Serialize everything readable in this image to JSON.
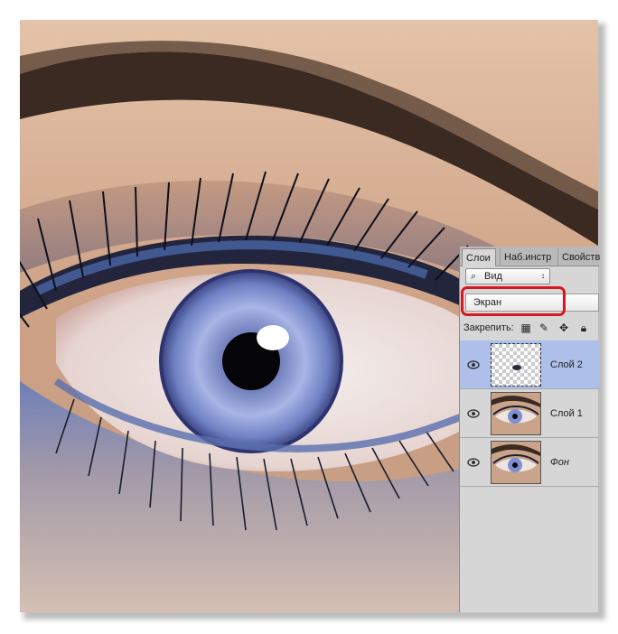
{
  "canvas": {
    "image_description_icon": "eye-photo",
    "colors": {
      "iris": "#7d8fd0",
      "skin": "#d8b396",
      "shadow": "#3e5a95"
    }
  },
  "layers_panel": {
    "tabs": [
      {
        "label": "Слои",
        "active": true
      },
      {
        "label": "Наб.инстр",
        "active": false
      },
      {
        "label": "Свойств",
        "active": false
      }
    ],
    "filter": {
      "icon": "search-icon",
      "label": "Вид"
    },
    "blend_mode": "Экран",
    "lock_label": "Закрепить:",
    "lock_icons": [
      "lock-transparent-icon",
      "lock-paint-icon",
      "lock-move-icon",
      "lock-all-icon"
    ],
    "layers": [
      {
        "name": "Слой 2",
        "selected": true,
        "visible": true,
        "italic": false
      },
      {
        "name": "Слой 1",
        "selected": false,
        "visible": true,
        "italic": false
      },
      {
        "name": "Фон",
        "selected": false,
        "visible": true,
        "italic": true
      }
    ],
    "highlight_color": "#d8181e",
    "selected_color": "#aebfea"
  }
}
